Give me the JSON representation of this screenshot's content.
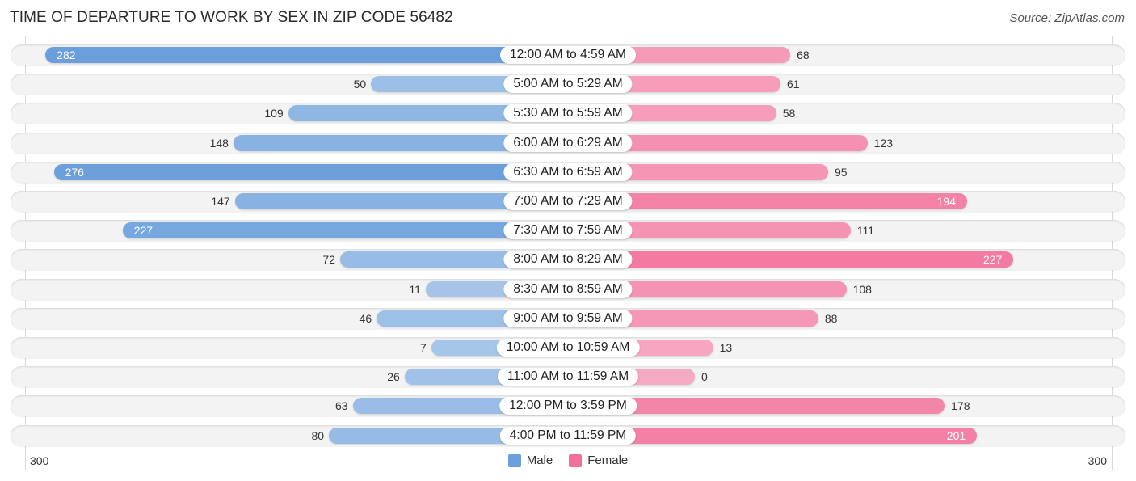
{
  "title": "TIME OF DEPARTURE TO WORK BY SEX IN ZIP CODE 56482",
  "source": "Source: ZipAtlas.com",
  "colors": {
    "male_strong": "#6a9fdb",
    "male_light": "#a7c6e9",
    "female_strong": "#f2709a",
    "female_light": "#f6a9c2"
  },
  "chart_data": {
    "type": "bar",
    "orientation": "horizontal-diverging",
    "title": "TIME OF DEPARTURE TO WORK BY SEX IN ZIP CODE 56482",
    "xlabel": "",
    "ylabel": "",
    "xlim": [
      -300,
      300
    ],
    "axis_tick_labels": {
      "left": "300",
      "right": "300"
    },
    "legend_position": "bottom-center",
    "categories": [
      "12:00 AM to 4:59 AM",
      "5:00 AM to 5:29 AM",
      "5:30 AM to 5:59 AM",
      "6:00 AM to 6:29 AM",
      "6:30 AM to 6:59 AM",
      "7:00 AM to 7:29 AM",
      "7:30 AM to 7:59 AM",
      "8:00 AM to 8:29 AM",
      "8:30 AM to 8:59 AM",
      "9:00 AM to 9:59 AM",
      "10:00 AM to 10:59 AM",
      "11:00 AM to 11:59 AM",
      "12:00 PM to 3:59 PM",
      "4:00 PM to 11:59 PM"
    ],
    "series": [
      {
        "name": "Male",
        "side": "left",
        "values": [
          282,
          50,
          109,
          148,
          276,
          147,
          227,
          72,
          11,
          46,
          7,
          26,
          63,
          80
        ]
      },
      {
        "name": "Female",
        "side": "right",
        "values": [
          68,
          61,
          58,
          123,
          95,
          194,
          111,
          227,
          108,
          88,
          13,
          0,
          178,
          201
        ]
      }
    ]
  },
  "legend": [
    {
      "label": "Male",
      "color": "#6a9fdb"
    },
    {
      "label": "Female",
      "color": "#f2709a"
    }
  ]
}
